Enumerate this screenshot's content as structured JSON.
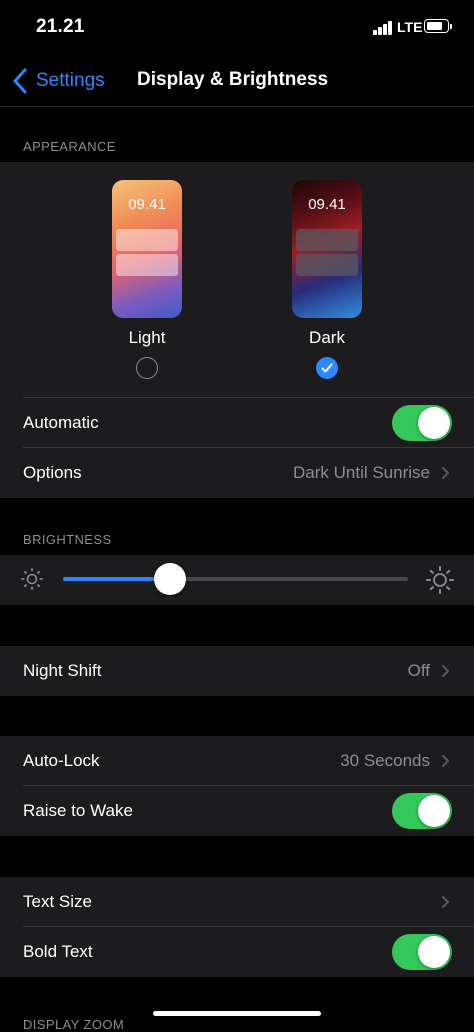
{
  "status": {
    "time": "21.21",
    "network": "LTE"
  },
  "nav": {
    "back_label": "Settings",
    "title": "Display & Brightness"
  },
  "appearance": {
    "header": "APPEARANCE",
    "light": {
      "preview_time": "09.41",
      "label": "Light",
      "selected": false
    },
    "dark": {
      "preview_time": "09.41",
      "label": "Dark",
      "selected": true
    },
    "automatic": {
      "label": "Automatic",
      "on": true
    },
    "options": {
      "label": "Options",
      "value": "Dark Until Sunrise"
    }
  },
  "brightness": {
    "header": "BRIGHTNESS",
    "level": 0.31
  },
  "night_shift": {
    "label": "Night Shift",
    "value": "Off"
  },
  "auto_lock": {
    "label": "Auto-Lock",
    "value": "30 Seconds"
  },
  "raise_to_wake": {
    "label": "Raise to Wake",
    "on": true
  },
  "text_size": {
    "label": "Text Size"
  },
  "bold_text": {
    "label": "Bold Text",
    "on": true
  },
  "next_header": "DISPLAY ZOOM",
  "colors": {
    "accent": "#2f87ff",
    "toggle_on": "#34c759",
    "cell_bg": "#1c1c1e",
    "secondary_text": "#8d8d93"
  }
}
